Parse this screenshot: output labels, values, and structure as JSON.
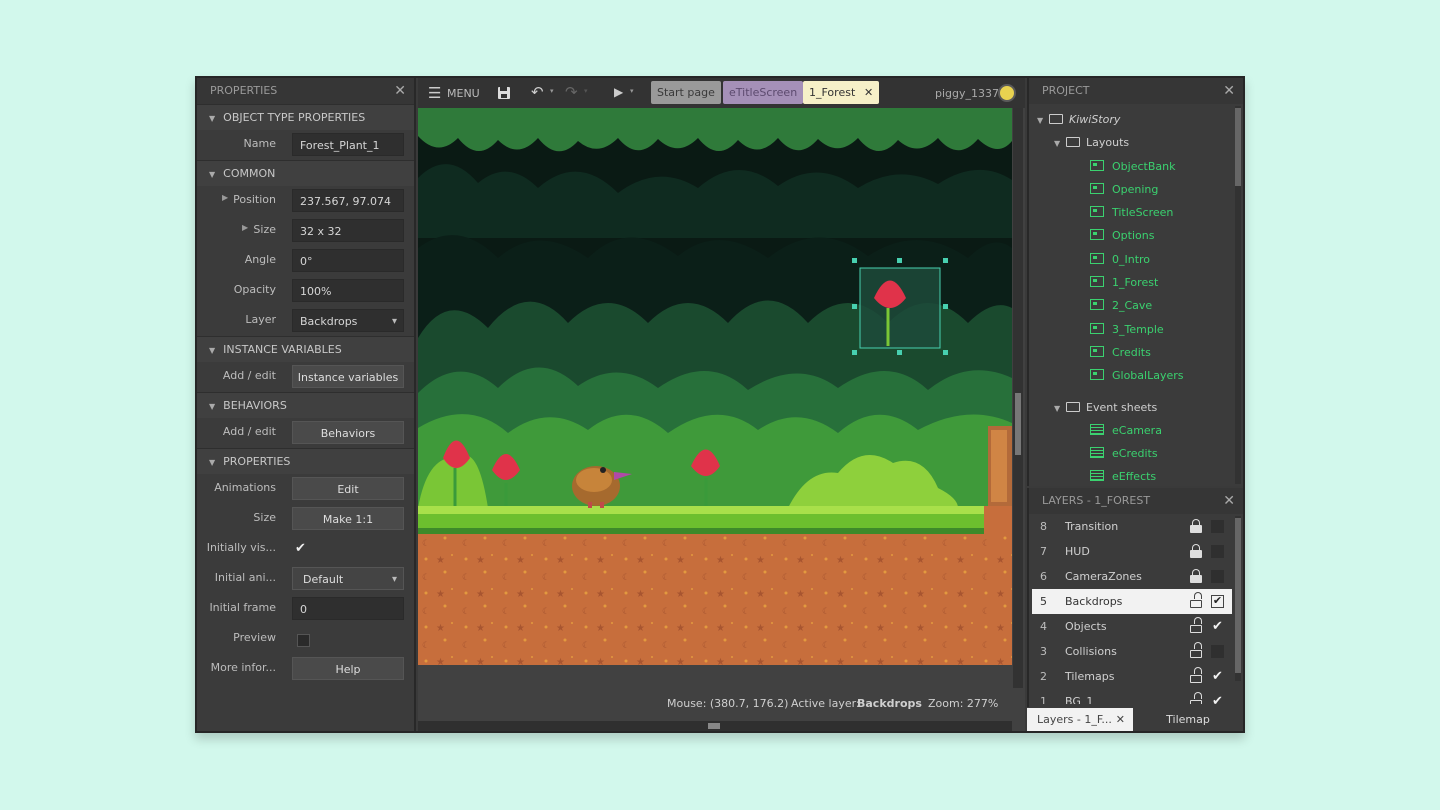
{
  "properties_panel": {
    "title": "PROPERTIES",
    "sections": {
      "object_type": "OBJECT TYPE PROPERTIES",
      "common": "COMMON",
      "instance_variables": "INSTANCE VARIABLES",
      "behaviors": "BEHAVIORS",
      "properties": "PROPERTIES"
    },
    "name_label": "Name",
    "name_value": "Forest_Plant_1",
    "position_label": "Position",
    "position_value": "237.567, 97.074",
    "size_label": "Size",
    "size_value": "32 x 32",
    "angle_label": "Angle",
    "angle_value": "0°",
    "opacity_label": "Opacity",
    "opacity_value": "100%",
    "layer_label": "Layer",
    "layer_value": "Backdrops",
    "add_edit_label": "Add / edit",
    "instance_variables_button": "Instance variables",
    "behaviors_button": "Behaviors",
    "animations_label": "Animations",
    "animations_button": "Edit",
    "size2_label": "Size",
    "make_1_1_button": "Make 1:1",
    "initially_visible_label": "Initially vis...",
    "initially_visible_checked": true,
    "initial_animation_label": "Initial ani...",
    "initial_animation_value": "Default",
    "initial_frame_label": "Initial frame",
    "initial_frame_value": "0",
    "preview_label": "Preview",
    "preview_checked": false,
    "more_info_label": "More infor...",
    "help_button": "Help"
  },
  "toolbar": {
    "menu_label": "MENU",
    "tabs": [
      {
        "label": "Start page",
        "bg": "#9a9a9a",
        "fg": "#3a3a3a"
      },
      {
        "label": "eTitleScreen",
        "bg": "#a590b8",
        "fg": "#5c4a6e"
      },
      {
        "label": "1_Forest",
        "bg": "#f6f0c8",
        "fg": "#333333"
      }
    ],
    "username": "piggy_1337"
  },
  "status": {
    "mouse": "Mouse: (380.7, 176.2)",
    "active_layer_label": "Active layer:",
    "active_layer_value": "Backdrops",
    "zoom": "Zoom: 277%"
  },
  "project_panel": {
    "title": "PROJECT",
    "root": "KiwiStory",
    "layouts_folder": "Layouts",
    "layouts": [
      "ObjectBank",
      "Opening",
      "TitleScreen",
      "Options",
      "0_Intro",
      "1_Forest",
      "2_Cave",
      "3_Temple",
      "Credits",
      "GlobalLayers"
    ],
    "event_sheets_folder": "Event sheets",
    "event_sheets": [
      "eCamera",
      "eCredits",
      "eEffects"
    ]
  },
  "layers_panel": {
    "title": "LAYERS - 1_FOREST",
    "layers": [
      {
        "num": "8",
        "name": "Transition",
        "locked": true,
        "visible": false,
        "selected": false
      },
      {
        "num": "7",
        "name": "HUD",
        "locked": true,
        "visible": false,
        "selected": false
      },
      {
        "num": "6",
        "name": "CameraZones",
        "locked": true,
        "visible": false,
        "selected": false
      },
      {
        "num": "5",
        "name": "Backdrops",
        "locked": false,
        "visible": true,
        "selected": true
      },
      {
        "num": "4",
        "name": "Objects",
        "locked": false,
        "visible": true,
        "selected": false
      },
      {
        "num": "3",
        "name": "Collisions",
        "locked": false,
        "visible": false,
        "selected": false
      },
      {
        "num": "2",
        "name": "Tilemaps",
        "locked": false,
        "visible": true,
        "selected": false
      },
      {
        "num": "1",
        "name": "BG_1",
        "locked": false,
        "visible": true,
        "selected": false
      }
    ],
    "bottom_tabs": [
      "Layers - 1_F...",
      "Tilemap"
    ]
  }
}
